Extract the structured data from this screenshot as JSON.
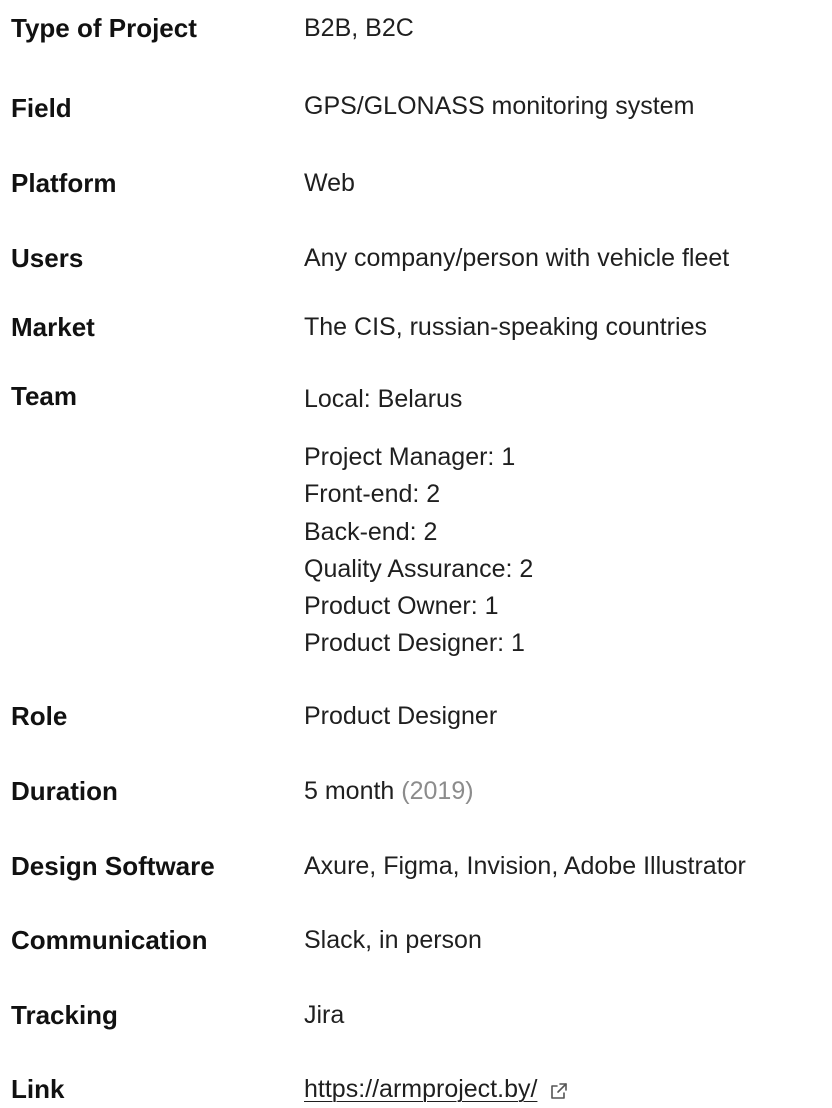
{
  "rows": {
    "type": {
      "label": "Type of Project",
      "value": "B2B, B2C"
    },
    "field": {
      "label": "Field",
      "value": "GPS/GLONASS monitoring system"
    },
    "platform": {
      "label": "Platform",
      "value": "Web"
    },
    "users": {
      "label": "Users",
      "value": "Any company/person with vehicle fleet"
    },
    "market": {
      "label": "Market",
      "value": "The CIS, russian-speaking countries"
    },
    "team": {
      "label": "Team",
      "location": "Local: Belarus",
      "members": [
        "Project Manager: 1",
        "Front-end: 2",
        "Back-end: 2",
        "Quality Assurance: 2",
        "Product Owner: 1",
        "Product Designer: 1"
      ]
    },
    "role": {
      "label": "Role",
      "value": "Product Designer"
    },
    "duration": {
      "label": "Duration",
      "value": "5 month",
      "year": "(2019)"
    },
    "software": {
      "label": "Design Software",
      "value": "Axure, Figma, Invision, Adobe Illustrator"
    },
    "communication": {
      "label": "Communication",
      "value": "Slack, in person"
    },
    "tracking": {
      "label": "Tracking",
      "value": "Jira"
    },
    "link": {
      "label": "Link",
      "value": "https://armproject.by/",
      "icon": "external-link-icon"
    }
  },
  "colors": {
    "text": "#1f1f1f",
    "muted": "#8c8c8c",
    "background": "#ffffff"
  }
}
